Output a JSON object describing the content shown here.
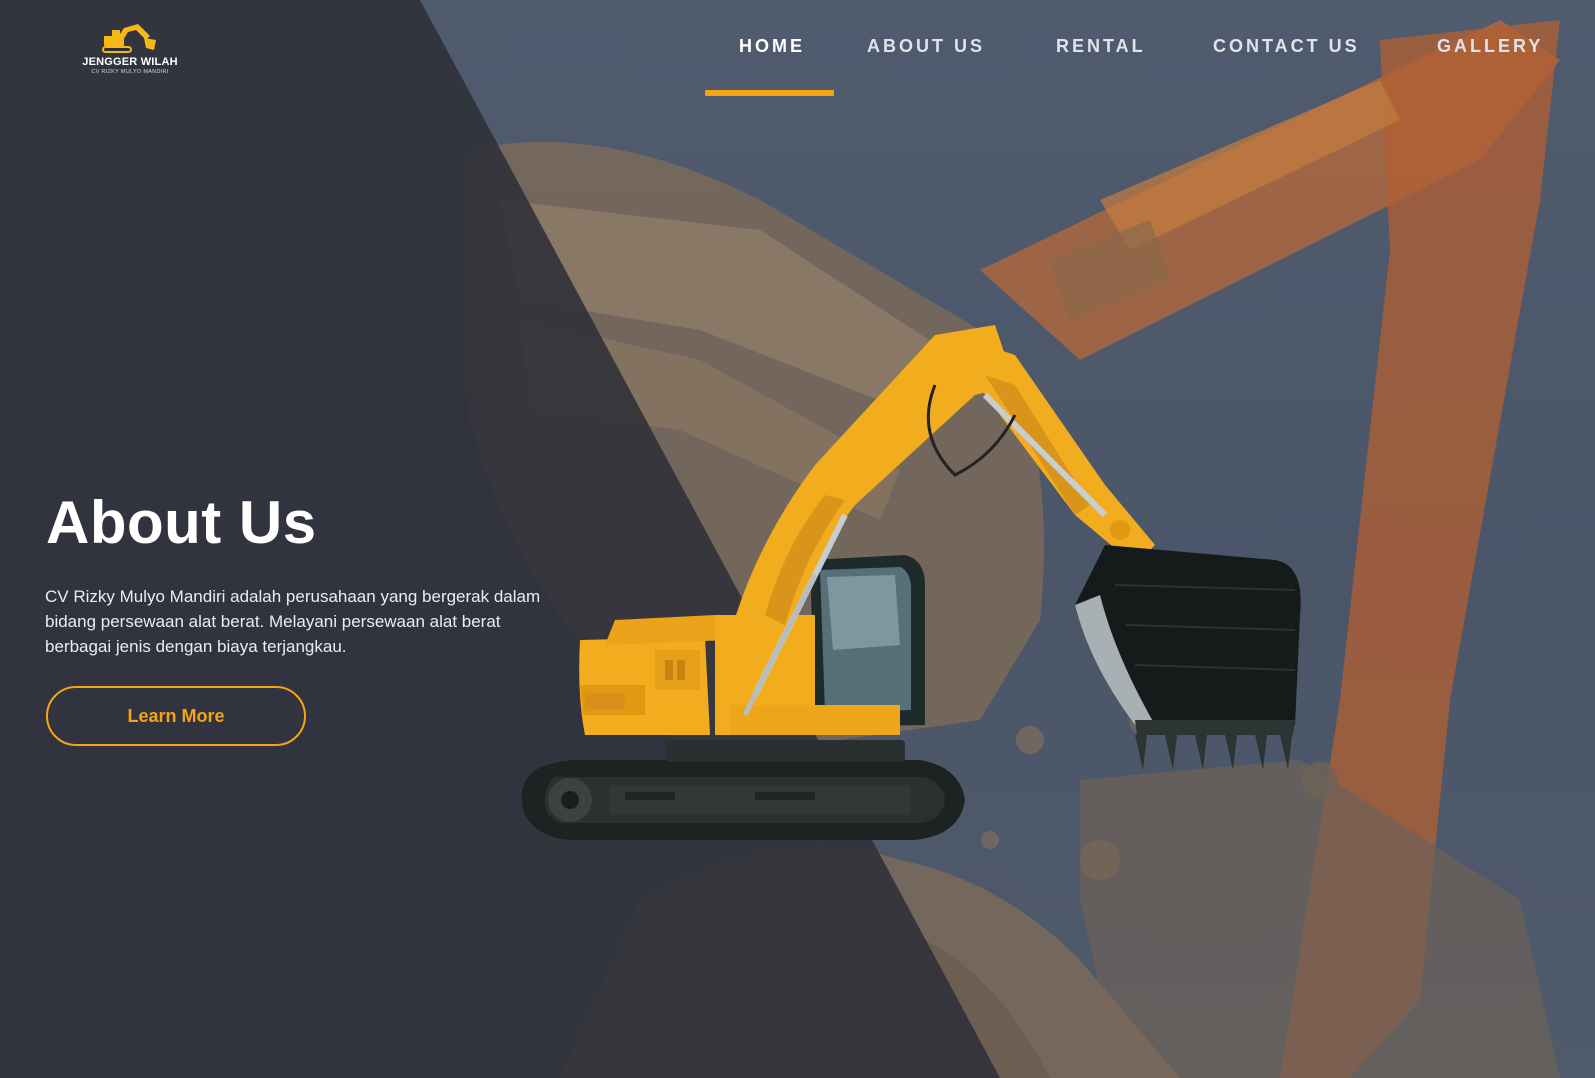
{
  "brand": {
    "name": "JENGGER WILAH",
    "tagline": "CV RIZKY MULYO MANDIRI"
  },
  "nav": {
    "items": [
      {
        "label": "HOME",
        "active": true
      },
      {
        "label": "ABOUT US",
        "active": false
      },
      {
        "label": "RENTAL",
        "active": false
      },
      {
        "label": "CONTACT US",
        "active": false
      },
      {
        "label": "GALLERY",
        "active": false
      }
    ]
  },
  "hero": {
    "title": "About Us",
    "description": "CV Rizky Mulyo Mandiri adalah perusahaan yang bergerak dalam bidang persewaan alat berat.  Melayani persewaan alat berat berbagai jenis dengan biaya terjangkau.",
    "cta_label": "Learn More"
  },
  "colors": {
    "accent": "#f5a414",
    "dark_panel": "#2d3038",
    "background": "#4a5567",
    "excavator_body": "#f2ad1e"
  },
  "icons": {
    "logo": "excavator-logo-icon",
    "hero_image": "excavator-illustration"
  }
}
